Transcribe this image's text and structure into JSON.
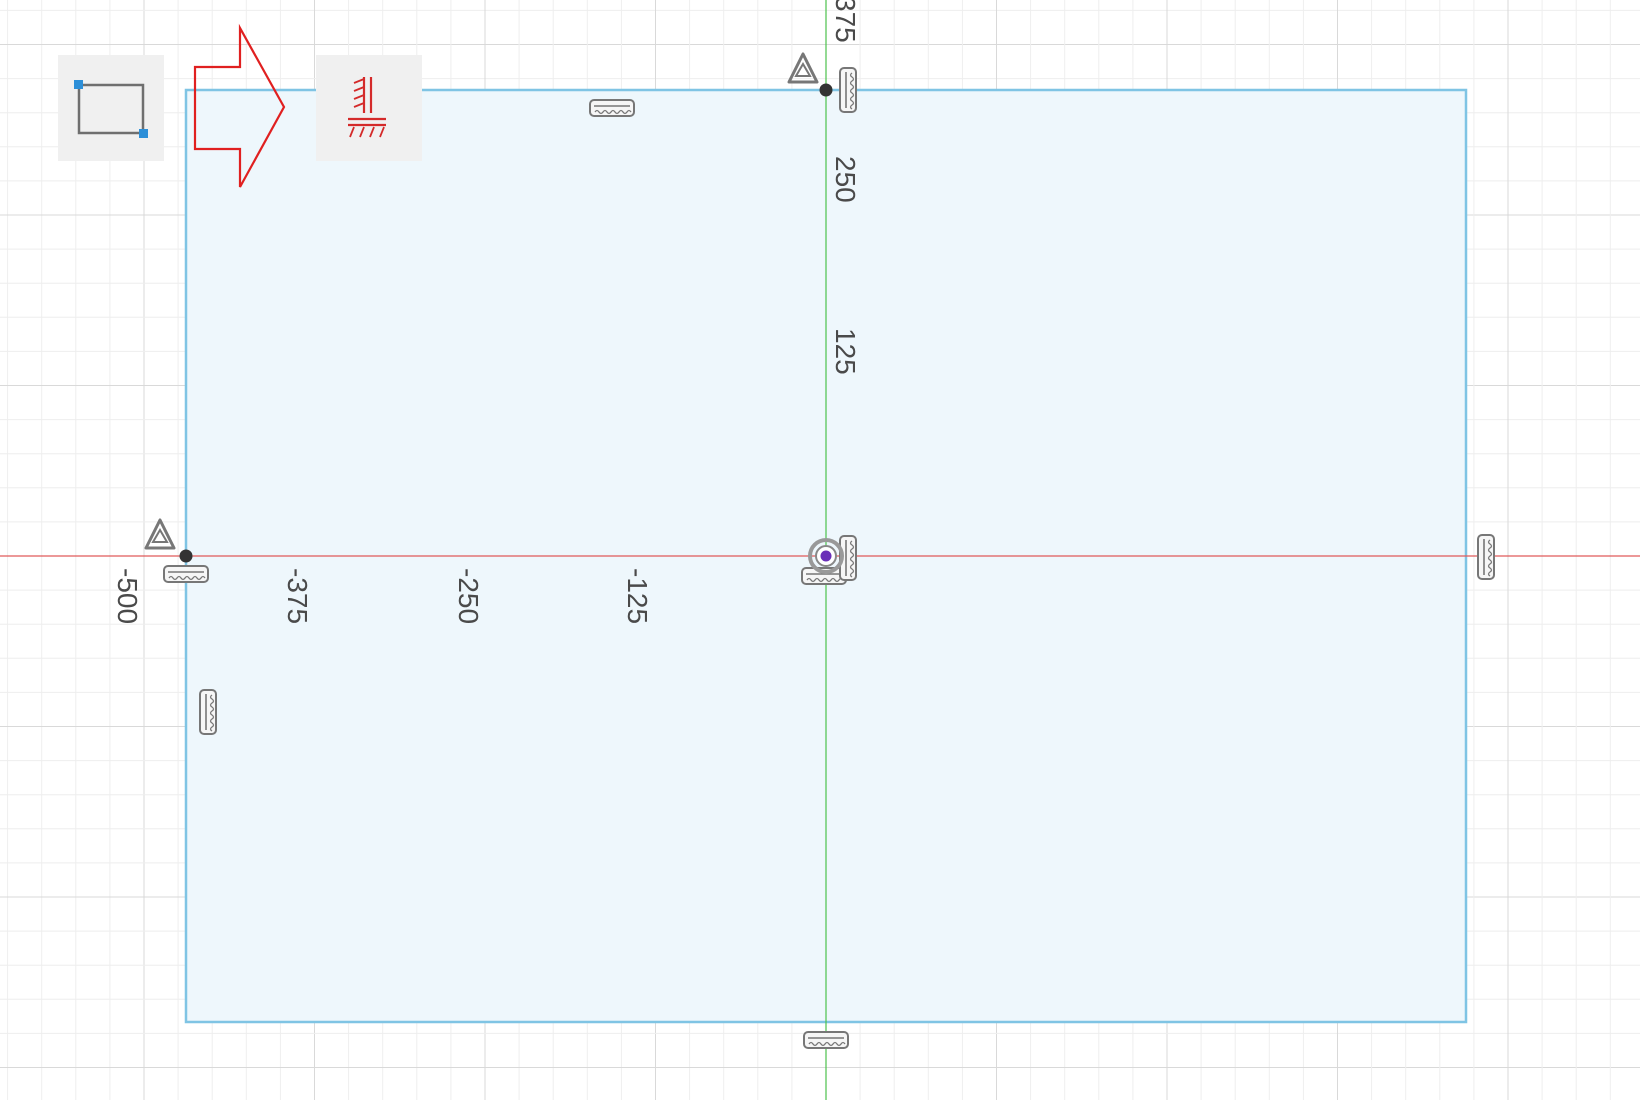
{
  "toolbar": {
    "rectangle_tool_icon": "2-point-rectangle-icon",
    "constraint_tool_icon": "fix-constraint-icon",
    "callout_arrow_icon": "right-arrow-outline-icon"
  },
  "axis_labels": {
    "x_ticks": [
      "-500",
      "-375",
      "-250",
      "-125"
    ],
    "y_ticks": [
      "375",
      "250",
      "125"
    ]
  },
  "colors": {
    "x_axis": "#e05a5a",
    "y_axis": "#4cc24c",
    "sketch_outline": "#7fc4e4",
    "sketch_fill": "#eef7fc",
    "grid_minor": "#eeeeee",
    "grid_major": "#d9d9d9",
    "callout_arrow": "#e02020",
    "constraint_icon": "#d42a2a",
    "origin_point": "#6a2fb8"
  },
  "glyphs": {
    "fix_point_marker": "triangle-fix-icon",
    "horizontal_constraint": "horizontal-constraint-icon",
    "vertical_constraint": "vertical-constraint-icon",
    "origin_marker": "origin-point-icon"
  }
}
